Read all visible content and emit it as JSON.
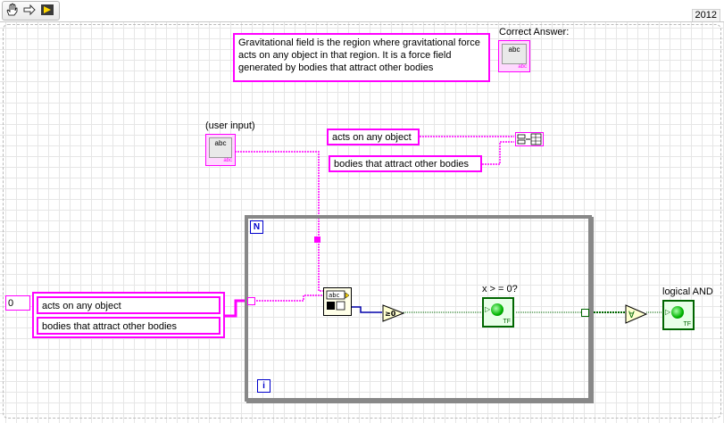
{
  "toolbar": {
    "icons": [
      "hand-icon",
      "step-arrow-icon",
      "run-icon"
    ],
    "version": "2012"
  },
  "constants": {
    "definition": "Gravitational field is the region where gravitational force acts on any object in that region. It is a force field generated by bodies that attract other bodies",
    "phrase1": "acts on any object",
    "phrase2": "bodies that attract other bodies"
  },
  "labels": {
    "correct_answer": "Correct Answer:",
    "user_input": "(user input)",
    "x_ge_zero": "x > = 0?",
    "logical_and": "logical AND"
  },
  "controls": {
    "string_glyph": "abc",
    "bool_glyph": "TF"
  },
  "array": {
    "index": "0",
    "items": [
      "acts on any object",
      "bodies that attract other bodies"
    ]
  },
  "loop": {
    "count_terminal": "N",
    "iteration_terminal": "i"
  },
  "functions": {
    "search_glyph": "abc",
    "compare_glyph": "≥0",
    "and_glyph": "∀"
  },
  "colors": {
    "string": "#ff00ff",
    "boolean": "#006600",
    "integer": "#0000cc"
  }
}
